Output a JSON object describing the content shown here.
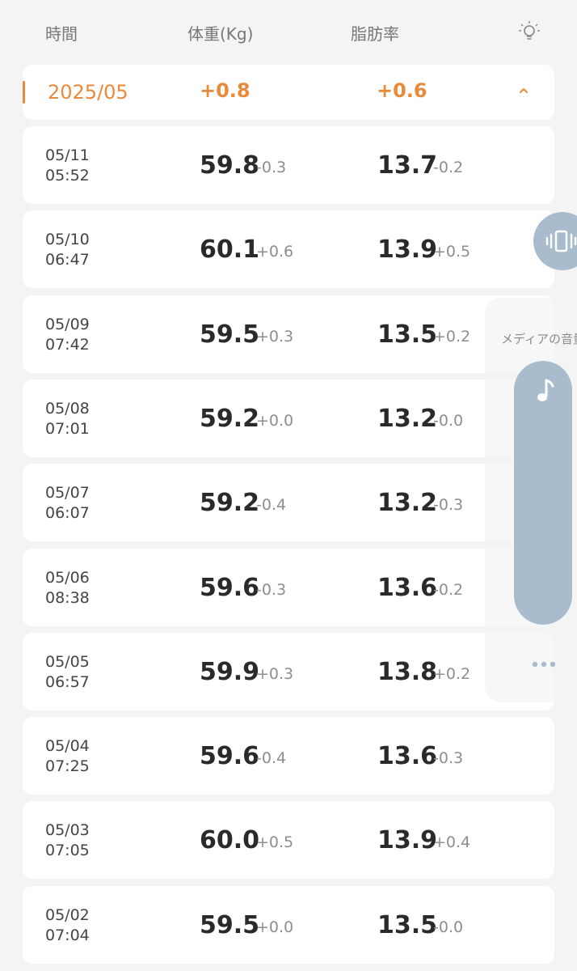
{
  "header": {
    "time_label": "時間",
    "weight_label": "体重(Kg)",
    "fat_label": "脂肪率",
    "icon": "lightbulb-icon"
  },
  "month": {
    "label": "2025/05",
    "weight_change": "+0.8",
    "fat_change": "+0.6",
    "accent_color": "#e88a3a",
    "icon": "chevron-up-icon"
  },
  "rows": [
    {
      "date": "05/11",
      "time": "05:52",
      "weight": "59.8",
      "weight_diff": "-0.3",
      "fat": "13.7",
      "fat_diff": "-0.2"
    },
    {
      "date": "05/10",
      "time": "06:47",
      "weight": "60.1",
      "weight_diff": "+0.6",
      "fat": "13.9",
      "fat_diff": "+0.5"
    },
    {
      "date": "05/09",
      "time": "07:42",
      "weight": "59.5",
      "weight_diff": "+0.3",
      "fat": "13.5",
      "fat_diff": "+0.2"
    },
    {
      "date": "05/08",
      "time": "07:01",
      "weight": "59.2",
      "weight_diff": "+0.0",
      "fat": "13.2",
      "fat_diff": "-0.0"
    },
    {
      "date": "05/07",
      "time": "06:07",
      "weight": "59.2",
      "weight_diff": "-0.4",
      "fat": "13.2",
      "fat_diff": "-0.3"
    },
    {
      "date": "05/06",
      "time": "08:38",
      "weight": "59.6",
      "weight_diff": "-0.3",
      "fat": "13.6",
      "fat_diff": "-0.2"
    },
    {
      "date": "05/05",
      "time": "06:57",
      "weight": "59.9",
      "weight_diff": "+0.3",
      "fat": "13.8",
      "fat_diff": "+0.2"
    },
    {
      "date": "05/04",
      "time": "07:25",
      "weight": "59.6",
      "weight_diff": "-0.4",
      "fat": "13.6",
      "fat_diff": "-0.3"
    },
    {
      "date": "05/03",
      "time": "07:05",
      "weight": "60.0",
      "weight_diff": "+0.5",
      "fat": "13.9",
      "fat_diff": "+0.4"
    },
    {
      "date": "05/02",
      "time": "07:04",
      "weight": "59.5",
      "weight_diff": "+0.0",
      "fat": "13.5",
      "fat_diff": "-0.0"
    }
  ],
  "volume_overlay": {
    "vibrate_icon": "vibrate-icon",
    "media_label": "メディアの音量",
    "music_icon": "music-note-icon",
    "more_icon": "more-dots-icon",
    "accent_color": "#a9bccd"
  }
}
